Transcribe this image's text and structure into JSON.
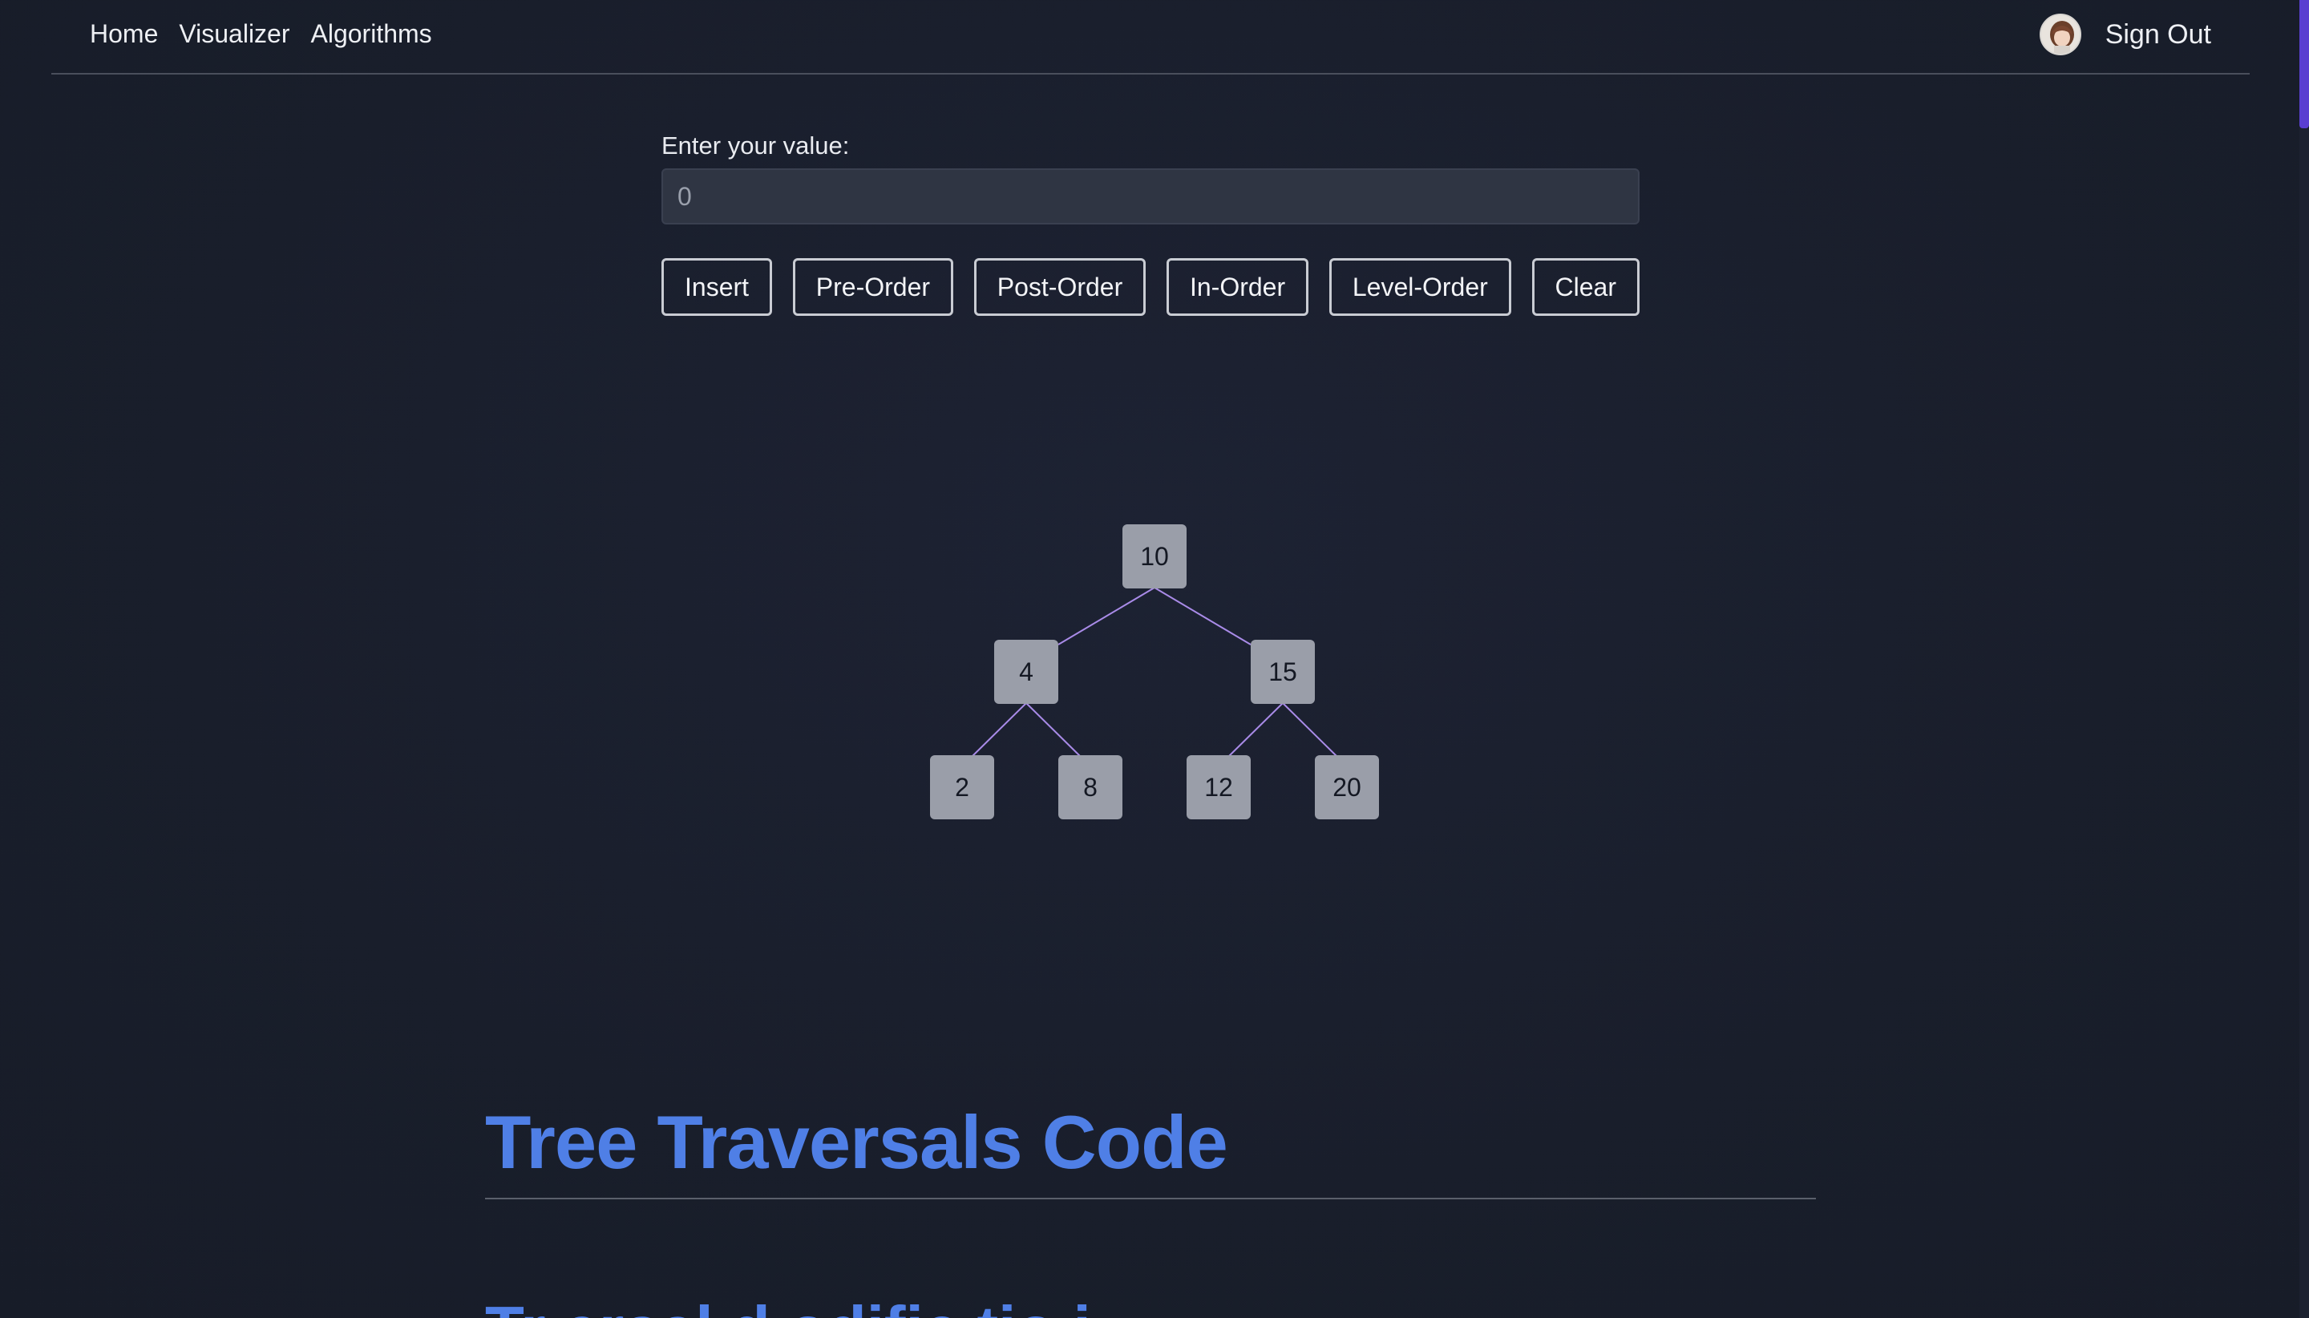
{
  "nav": {
    "links": [
      "Home",
      "Visualizer",
      "Algorithms"
    ],
    "sign_out": "Sign Out",
    "avatar_icon": "user-avatar-icon"
  },
  "controls": {
    "label": "Enter your value:",
    "input_value": "",
    "input_placeholder": "0",
    "buttons": [
      "Insert",
      "Pre-Order",
      "Post-Order",
      "In-Order",
      "Level-Order",
      "Clear"
    ]
  },
  "tree": {
    "root": "10",
    "level1": [
      "4",
      "15"
    ],
    "level2": [
      "2",
      "8",
      "12",
      "20"
    ],
    "edge_color": "#a98be8"
  },
  "section": {
    "title": "Tree Traversals Code",
    "subtitle": "Tr                  ersal                 d     odific  tio                                            i"
  },
  "colors": {
    "accent": "#4f7fe6",
    "node": "#9a9ea9",
    "scroll": "#5a3fd1"
  }
}
